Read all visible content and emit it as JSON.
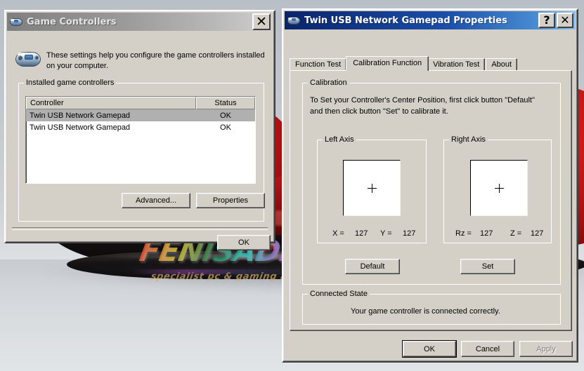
{
  "background": {
    "photo_description": "red sports car front splitter",
    "watermark_main": "FENISADRIVE",
    "watermark_sub": "specialist pc & gaming accessories"
  },
  "game_controllers_dialog": {
    "title": "Game Controllers",
    "icon": "gamepad-icon",
    "close_label": "✕",
    "info_text": "These settings help you configure the game controllers installed on your computer.",
    "group_title": "Installed game controllers",
    "columns": [
      "Controller",
      "Status"
    ],
    "rows": [
      {
        "controller": "Twin USB Network Gamepad",
        "status": "OK",
        "selected": true
      },
      {
        "controller": "Twin USB Network Gamepad",
        "status": "OK",
        "selected": false
      }
    ],
    "advanced_label": "Advanced...",
    "properties_label": "Properties",
    "ok_label": "OK"
  },
  "properties_dialog": {
    "title": "Twin USB Network Gamepad Properties",
    "icon": "gamepad-icon",
    "help_label": "?",
    "close_label": "✕",
    "tabs": [
      {
        "label": "Function Test",
        "active": false
      },
      {
        "label": "Calibration Function",
        "active": true
      },
      {
        "label": "Vibration Test",
        "active": false
      },
      {
        "label": "About",
        "active": false
      }
    ],
    "calibration": {
      "group_title": "Calibration",
      "instructions_line1": "To Set your Controller's  Center Position, first click button \"Default\"",
      "instructions_line2": "and then click button \"Set\" to calibrate it.",
      "left_axis": {
        "group_title": "Left Axis",
        "x_label": "X =",
        "x_value": "127",
        "y_label": "Y =",
        "y_value": "127"
      },
      "right_axis": {
        "group_title": "Right Axis",
        "rz_label": "Rz =",
        "rz_value": "127",
        "z_label": "Z =",
        "z_value": "127"
      },
      "default_label": "Default",
      "set_label": "Set"
    },
    "connected_state": {
      "group_title": "Connected State",
      "message": "Your game controller is connected correctly."
    },
    "ok_label": "OK",
    "cancel_label": "Cancel",
    "apply_label": "Apply"
  },
  "colors": {
    "face": "#d4d0c8",
    "active_title_start": "#0a246a",
    "active_title_end": "#93bfe8",
    "inactive_title_start": "#7f7f7f",
    "selection": "#b0b0b0",
    "disabled_text": "#808080"
  }
}
